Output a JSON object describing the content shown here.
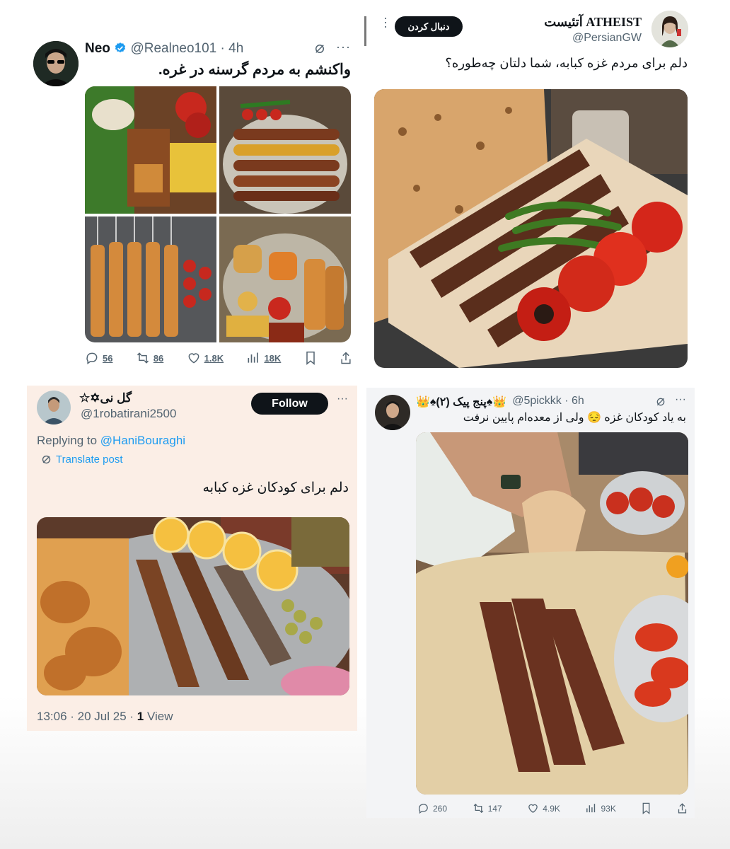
{
  "card1": {
    "name": "Neo",
    "handle": "@Realneo101",
    "time": "· 4h",
    "text": "واکنشم به مردم گرسنه در غره.",
    "stats": {
      "replies": "56",
      "retweets": "86",
      "likes": "1.8K",
      "views": "18K"
    }
  },
  "card2": {
    "name": "ATHEIST آتئیست",
    "handle": "@PersianGW",
    "follow": "دنبال کردن",
    "text": "دلم برای مردم غزه کبابه، شما دلتان چه‌طوره؟"
  },
  "card3": {
    "name": "گل نی✡︎☆",
    "handle": "@1robatirani2500",
    "follow": "Follow",
    "replying_prefix": "Replying to",
    "replying_handle": "@HaniBouraghi",
    "translate": "Translate post",
    "text": "دلم برای کودکان غزه کبابه",
    "date": "13:06 · 20 Jul 25 ·",
    "views_count": "1",
    "views_label": "View"
  },
  "card4": {
    "name": "👑♠پنج پیک (۲)♠👑",
    "handle": "@5pickkk · 6h",
    "text": "به یاد کودکان غزه 😔 ولی از معده‌ام پایین نرفت",
    "stats": {
      "replies": "260",
      "retweets": "147",
      "likes": "4.9K",
      "views": "93K"
    }
  },
  "colors": {
    "link": "#1d9bf0",
    "muted": "#536471",
    "card3_bg": "#fbeee6",
    "card4_bg": "#f3f4f6"
  }
}
